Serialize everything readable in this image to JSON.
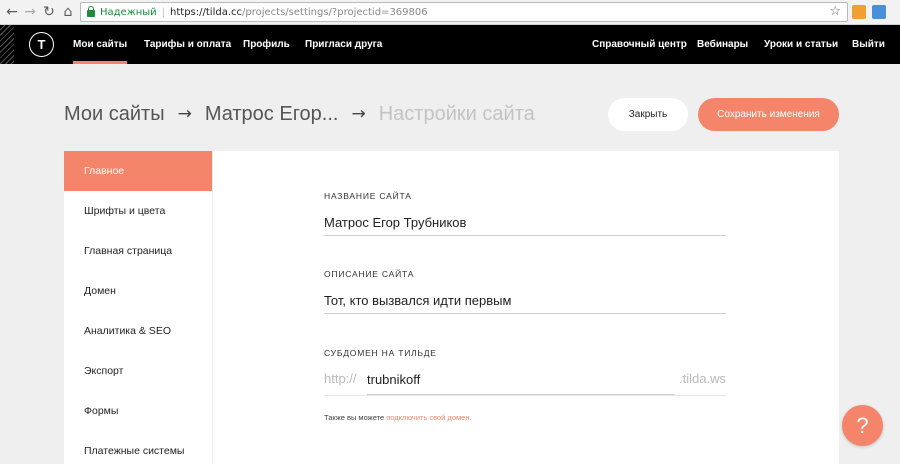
{
  "browser": {
    "secure_label": "Надежный",
    "url_host": "https://tilda.cc",
    "url_path": "/projects/settings/?projectid=369806",
    "back_icon": "←",
    "forward_icon": "→",
    "reload_icon": "↻",
    "home_icon": "⌂",
    "star_icon": "☆"
  },
  "logo": {
    "glyph": "T"
  },
  "nav": {
    "left": [
      "Мои сайты",
      "Тарифы и оплата",
      "Профиль",
      "Пригласи друга"
    ],
    "right": [
      "Справочный центр",
      "Вебинары",
      "Уроки и статьи",
      "Выйти"
    ]
  },
  "header": {
    "crumb1": "Мои сайты",
    "crumb2": "Матрос Егор...",
    "crumb3": "Настройки сайта",
    "arrow": "→",
    "close_label": "Закрыть",
    "save_label": "Сохранить изменения"
  },
  "sidebar": {
    "items": [
      "Главное",
      "Шрифты и цвета",
      "Главная страница",
      "Домен",
      "Аналитика & SEO",
      "Экспорт",
      "Формы",
      "Платежные системы"
    ]
  },
  "form": {
    "site_name_label": "НАЗВАНИЕ САЙТА",
    "site_name_value": "Матрос Егор Трубников",
    "site_desc_label": "ОПИСАНИЕ САЙТА",
    "site_desc_value": "Тот, кто вызвался идти первым",
    "subdomain_label": "СУБДОМЕН НА ТИЛЬДЕ",
    "subdomain_prefix": "http://",
    "subdomain_value": "trubnikoff",
    "subdomain_suffix": ".tilda.ws",
    "note_text": "Также вы можете ",
    "note_link": "подключить свой домен."
  },
  "help": {
    "glyph": "?"
  },
  "colors": {
    "accent": "#f4846a",
    "nav_bg": "#000000",
    "page_bg": "#efefef"
  }
}
